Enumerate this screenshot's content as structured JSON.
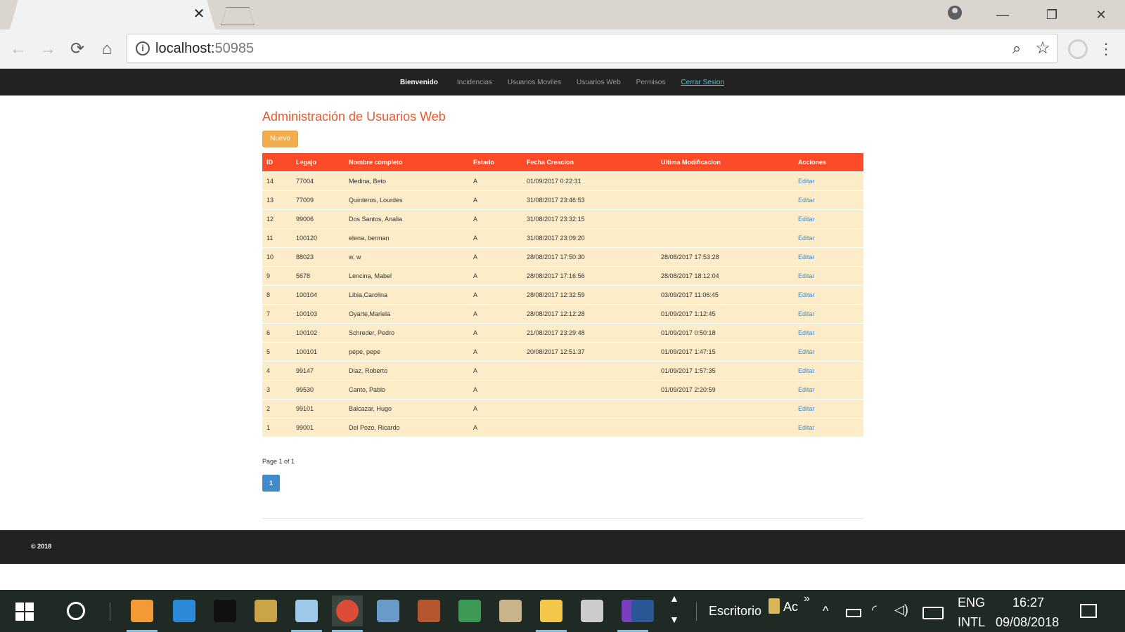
{
  "browser": {
    "tab_close": "✕",
    "url_host": "localhost:",
    "url_port": "50985",
    "back_icon": "←",
    "forward_icon": "→",
    "reload_icon": "⟳",
    "home_icon": "⌂",
    "info_icon": "i",
    "zoom_icon": "⌕",
    "star_icon": "☆",
    "menu_icon": "⋮",
    "minimize": "—",
    "restore": "❐",
    "close": "✕"
  },
  "navbar": {
    "brand": "Bienvenido",
    "links": [
      "Incidencias",
      "Usuarios Moviles",
      "Usuarios Web",
      "Permisos"
    ],
    "logout": "Cerrar Sesion"
  },
  "page": {
    "title": "Administración de Usuarios Web",
    "new_button": "Nuevo",
    "table": {
      "headers": [
        "ID",
        "Legajo",
        "Nombre completo",
        "Estado",
        "Fecha Creacion",
        "Ultima Modificacion",
        "Acciones"
      ],
      "rows": [
        [
          "14",
          "77004",
          "Medina, Beto",
          "A",
          "01/09/2017 0:22:31",
          "",
          "Editar"
        ],
        [
          "13",
          "77009",
          "Quinteros, Lourdes",
          "A",
          "31/08/2017 23:46:53",
          "",
          "Editar"
        ],
        [
          "12",
          "99006",
          "Dos Santos, Analia",
          "A",
          "31/08/2017 23:32:15",
          "",
          "Editar"
        ],
        [
          "11",
          "100120",
          "elena, berman",
          "A",
          "31/08/2017 23:09:20",
          "",
          "Editar"
        ],
        [
          "10",
          "88023",
          "w, w",
          "A",
          "28/08/2017 17:50:30",
          "28/08/2017 17:53:28",
          "Editar"
        ],
        [
          "9",
          "5678",
          "Lencina, Mabel",
          "A",
          "28/08/2017 17:16:56",
          "28/08/2017 18:12:04",
          "Editar"
        ],
        [
          "8",
          "100104",
          "Libia,Carolina",
          "A",
          "28/08/2017 12:32:59",
          "03/09/2017 11:06:45",
          "Editar"
        ],
        [
          "7",
          "100103",
          "Oyarte,Mariela",
          "A",
          "28/08/2017 12:12:28",
          "01/09/2017 1:12:45",
          "Editar"
        ],
        [
          "6",
          "100102",
          "Schreder, Pedro",
          "A",
          "21/08/2017 23:29:48",
          "01/09/2017 0:50:18",
          "Editar"
        ],
        [
          "5",
          "100101",
          "pepe, pepe",
          "A",
          "20/08/2017 12:51:37",
          "01/09/2017 1:47:15",
          "Editar"
        ],
        [
          "4",
          "99147",
          "Diaz, Roberto",
          "A",
          "",
          "01/09/2017 1:57:35",
          "Editar"
        ],
        [
          "3",
          "99530",
          "Canto, Pablo",
          "A",
          "",
          "01/09/2017 2:20:59",
          "Editar"
        ],
        [
          "2",
          "99101",
          "Balcazar, Hugo",
          "A",
          "",
          "",
          "Editar"
        ],
        [
          "1",
          "99001",
          "Del Pozo, Ricardo",
          "A",
          "",
          "",
          "Editar"
        ]
      ]
    },
    "pager_text": "Page 1 of 1",
    "current_page": "1"
  },
  "footer": {
    "text": "© 2018"
  },
  "taskbar": {
    "desktop_label": "Escritorio",
    "ac_label": "Ac",
    "more": "»",
    "lang": "ENG",
    "layout": "INTL",
    "time": "16:27",
    "date": "09/08/2018",
    "tray_up": "^",
    "apps": [
      {
        "name": "sublime",
        "color": "#f29a36"
      },
      {
        "name": "ie",
        "color": "#2a8ad8"
      },
      {
        "name": "cmd",
        "color": "#111111"
      },
      {
        "name": "tools",
        "color": "#c9a449"
      },
      {
        "name": "notepad",
        "color": "#9fc9e8"
      },
      {
        "name": "chrome",
        "color": "#dd4b39"
      },
      {
        "name": "server",
        "color": "#6a9ac8"
      },
      {
        "name": "firewall",
        "color": "#b5562f"
      },
      {
        "name": "network",
        "color": "#3d9a56"
      },
      {
        "name": "paint",
        "color": "#c8b48a"
      },
      {
        "name": "explorer",
        "color": "#f3c74a"
      },
      {
        "name": "calculator",
        "color": "#cccccc"
      },
      {
        "name": "visual-studio",
        "color": "#7a3fbf"
      },
      {
        "name": "word",
        "color": "#2b5797"
      }
    ]
  }
}
